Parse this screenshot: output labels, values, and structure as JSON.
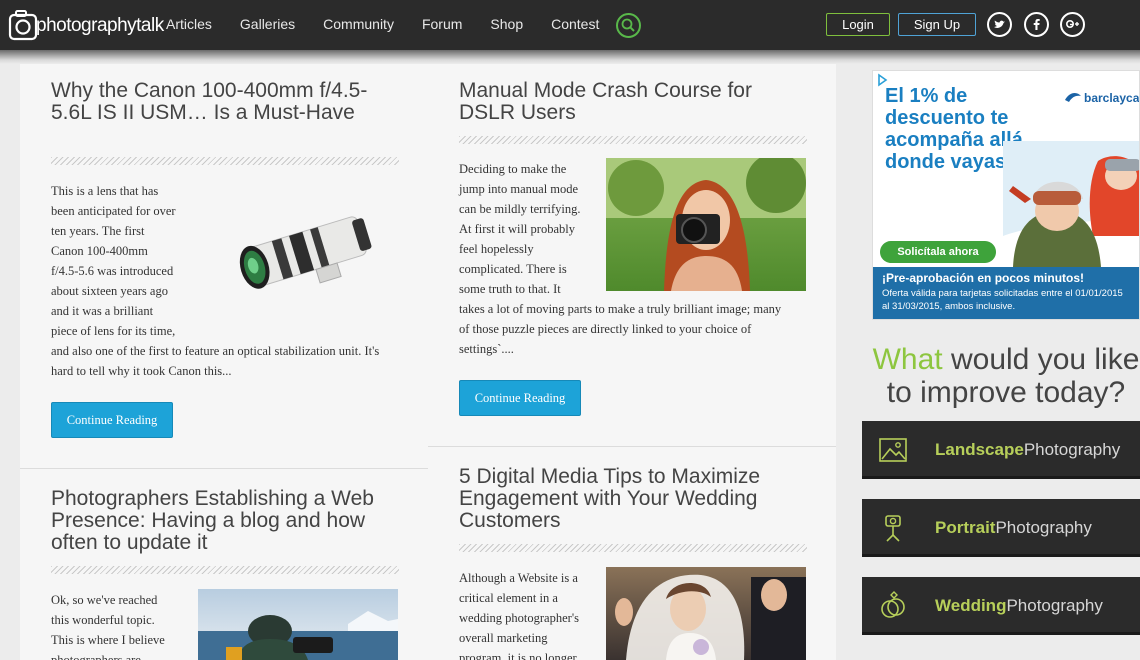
{
  "nav": {
    "logo_text": "photographytalk",
    "links": [
      "Articles",
      "Galleries",
      "Community",
      "Forum",
      "Shop",
      "Contest"
    ],
    "login": "Login",
    "signup": "Sign Up"
  },
  "posts": [
    {
      "title": "Why the Canon 100-400mm f/4.5-5.6L IS II USM… Is a Must-Have",
      "text_wrap": [
        "This is a lens that has",
        "been anticipated for over",
        "ten years. The first",
        "Canon 100-400mm",
        "f/4.5-5.6 was introduced",
        "about sixteen years ago",
        "and it was a brilliant",
        "piece of lens for its time,"
      ],
      "text_full": [
        "and also one of the first to feature an optical stabilization unit. It's",
        "hard to tell why it took Canon this..."
      ],
      "button": "Continue Reading"
    },
    {
      "title": "Manual Mode Crash Course for DSLR Users",
      "text_wrap": [
        "Deciding to make the",
        "jump into manual mode",
        "can be mildly terrifying.",
        "At first it will probably",
        "feel hopelessly",
        "complicated. There is",
        "some truth to that. It"
      ],
      "text_full": [
        "takes a lot of moving parts to make a truly brilliant image; many",
        "of those puzzle pieces are directly linked to your choice of",
        "settings`...."
      ],
      "button": "Continue Reading"
    },
    {
      "title": "Photographers Establishing a Web Presence: Having a blog and how often to update it",
      "text_wrap": [
        "Ok, so we've reached",
        "this wonderful topic.",
        "This is where I believe",
        "photographers are"
      ]
    },
    {
      "title": "5 Digital Media Tips to Maximize Engagement with Your Wedding Customers",
      "text_wrap": [
        "Although a Website is a",
        "critical element in a",
        "wedding photographer's",
        "overall marketing",
        "program, it is no longer"
      ]
    }
  ],
  "ad": {
    "headline": "El 1% de descuento te acompaña allá donde vayas",
    "brand": "barclaycard",
    "cta": "Solicítala ahora",
    "band_title": "¡Pre-aprobación en pocos minutos!",
    "band_fine": "Oferta válida para tarjetas solicitadas entre el 01/01/2015 al 31/03/2015, ambos inclusive."
  },
  "sidebar": {
    "question_accent": "What",
    "question_rest": "would you like to improve today?",
    "categories": [
      {
        "bold": "Landscape",
        "rest": "Photography",
        "icon": "landscape-icon"
      },
      {
        "bold": "Portrait",
        "rest": "Photography",
        "icon": "portrait-icon"
      },
      {
        "bold": "Wedding",
        "rest": "Photography",
        "icon": "wedding-rings-icon"
      }
    ]
  },
  "colors": {
    "accent_green": "#8dc63f",
    "button_blue": "#1da3d8",
    "nav_bg": "#2b2b2b"
  }
}
